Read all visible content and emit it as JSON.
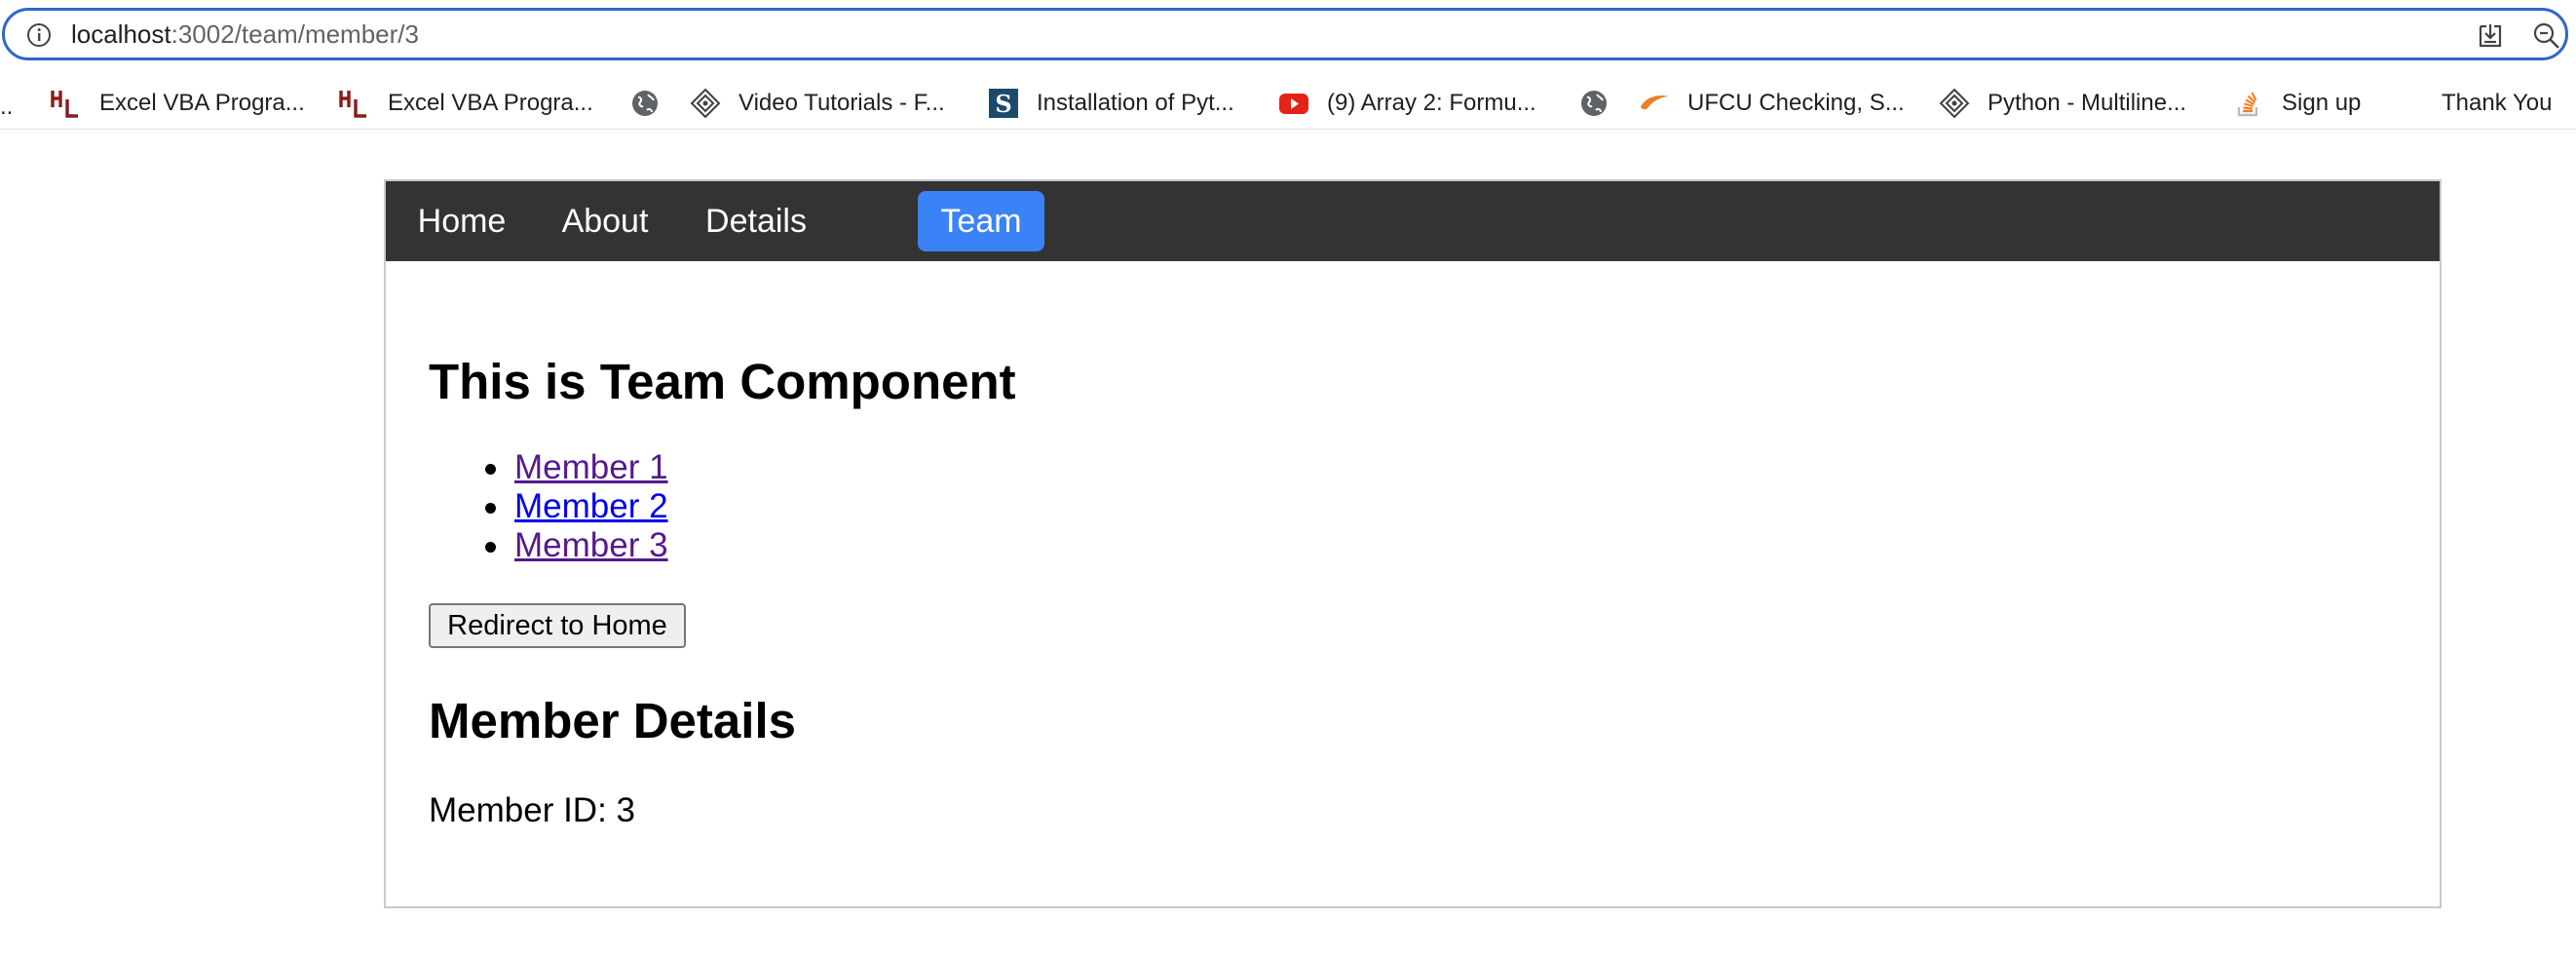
{
  "browser": {
    "url_host": "localhost",
    "url_path": ":3002/team/member/3"
  },
  "bookmarks": {
    "leading_ellipsis": "..",
    "items": [
      {
        "label": "Excel VBA Progra...",
        "icon": "hl-logo-icon"
      },
      {
        "label": "Excel VBA Progra...",
        "icon": "hl-logo-icon"
      },
      {
        "label": "",
        "icon": "globe-icon"
      },
      {
        "label": "Video Tutorials - F...",
        "icon": "diamond-logo-icon"
      },
      {
        "label": "Installation of Pyt...",
        "icon": "s-logo-icon"
      },
      {
        "label": "(9) Array 2: Formu...",
        "icon": "youtube-icon"
      },
      {
        "label": "",
        "icon": "globe-icon"
      },
      {
        "label": "UFCU Checking, S...",
        "icon": "swoosh-icon"
      },
      {
        "label": "Python - Multiline...",
        "icon": "diamond-logo-icon"
      },
      {
        "label": "Sign up",
        "icon": "stackoverflow-icon"
      },
      {
        "label": "Thank You",
        "icon": ""
      }
    ]
  },
  "nav": {
    "items": [
      {
        "label": "Home",
        "active": false
      },
      {
        "label": "About",
        "active": false
      },
      {
        "label": "Details",
        "active": false
      },
      {
        "label": "Team",
        "active": true
      }
    ],
    "active_color": "#3b82f6",
    "bar_color": "#333333"
  },
  "team": {
    "title": "This is Team Component",
    "members": [
      {
        "label": "Member 1",
        "visited": true
      },
      {
        "label": "Member 2",
        "visited": false
      },
      {
        "label": "Member 3",
        "visited": true
      }
    ],
    "redirect_button": "Redirect to Home"
  },
  "details": {
    "title": "Member Details",
    "member_id_text": "Member ID: 3"
  }
}
